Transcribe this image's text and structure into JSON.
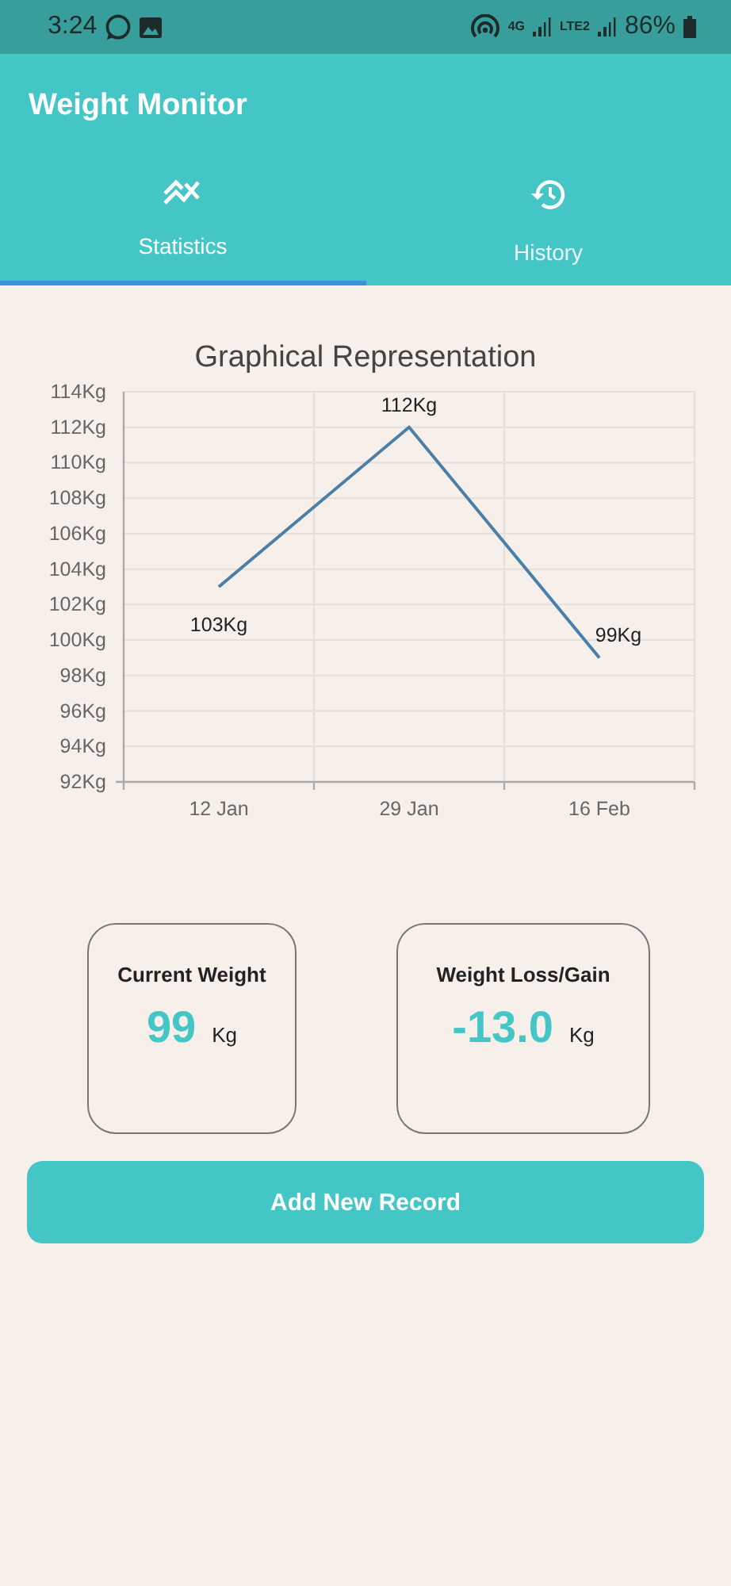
{
  "status_bar": {
    "time": "3:24",
    "network_1": "4G",
    "network_2": "LTE2",
    "battery": "86%"
  },
  "app_bar": {
    "title": "Weight Monitor"
  },
  "tabs": [
    {
      "label": "Statistics",
      "kind": "statistics",
      "selected": true
    },
    {
      "label": "History",
      "kind": "history",
      "selected": false
    }
  ],
  "chart": {
    "chart_data": {
      "type": "line",
      "title": "Graphical Representation",
      "categories": [
        "12 Jan",
        "29 Jan",
        "16 Feb"
      ],
      "series": [
        {
          "color": "#4a7fa8",
          "values": [
            103,
            112,
            99
          ]
        }
      ],
      "ylim": [
        92,
        114
      ],
      "yticks": [
        {
          "value": 92,
          "label": "92Kg"
        },
        {
          "value": 94,
          "label": "94Kg"
        },
        {
          "value": 96,
          "label": "96Kg"
        },
        {
          "value": 98,
          "label": "98Kg"
        },
        {
          "value": 100,
          "label": "100Kg"
        },
        {
          "value": 102,
          "label": "102Kg"
        },
        {
          "value": 104,
          "label": "104Kg"
        },
        {
          "value": 106,
          "label": "106Kg"
        },
        {
          "value": 108,
          "label": "108Kg"
        },
        {
          "value": 110,
          "label": "110Kg"
        },
        {
          "value": 112,
          "label": "112Kg"
        },
        {
          "value": 114,
          "label": "114Kg"
        }
      ],
      "value_labels": [
        "103Kg",
        "112Kg",
        "99Kg"
      ],
      "grid": true
    }
  },
  "cards": [
    {
      "title": "Current Weight",
      "value": "99",
      "unit": "Kg"
    },
    {
      "title": "Weight Loss/Gain",
      "value": "-13.0",
      "unit": "Kg"
    }
  ],
  "button": {
    "label": "Add New Record"
  }
}
